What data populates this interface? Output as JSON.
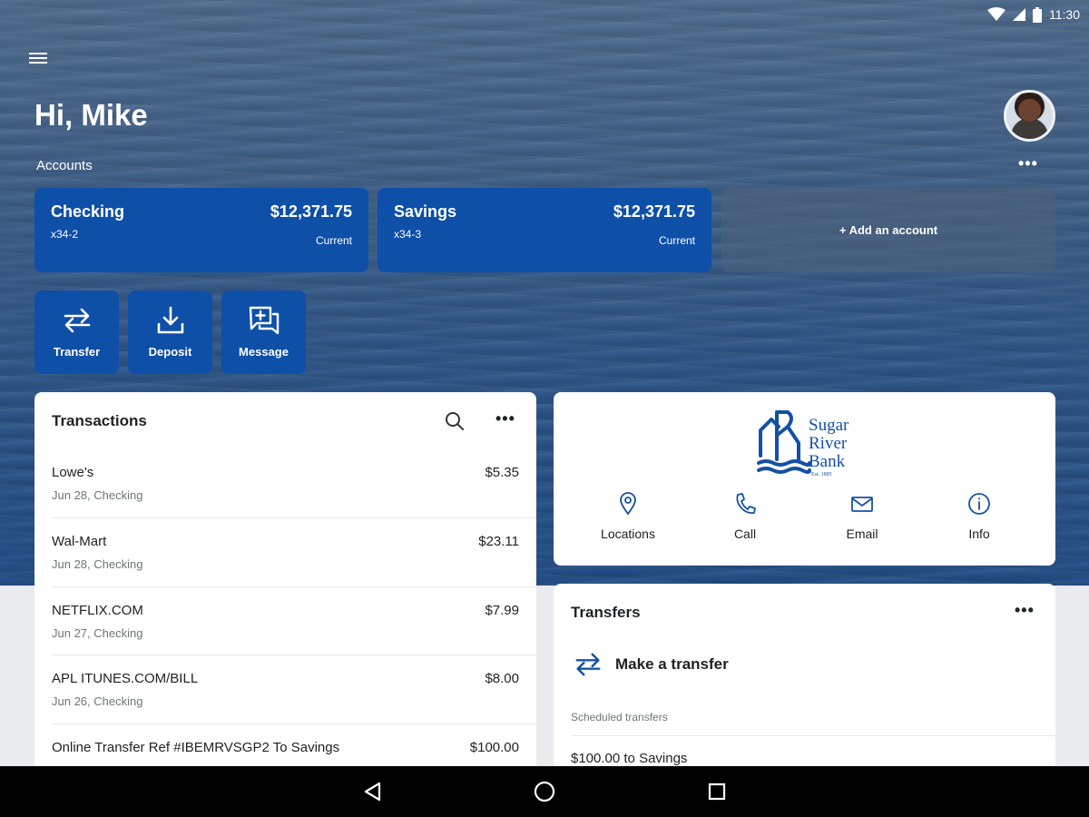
{
  "status_bar": {
    "time": "11:30"
  },
  "header": {
    "greeting": "Hi, Mike"
  },
  "accounts": {
    "label": "Accounts",
    "items": [
      {
        "name": "Checking",
        "number": "x34-2",
        "balance": "$12,371.75",
        "balance_type": "Current"
      },
      {
        "name": "Savings",
        "number": "x34-3",
        "balance": "$12,371.75",
        "balance_type": "Current"
      }
    ],
    "add_label": "+ Add an account"
  },
  "quick_actions": [
    {
      "label": "Transfer",
      "icon": "transfer-icon"
    },
    {
      "label": "Deposit",
      "icon": "deposit-icon"
    },
    {
      "label": "Message",
      "icon": "message-icon"
    }
  ],
  "transactions": {
    "title": "Transactions",
    "items": [
      {
        "name": "Lowe's",
        "sub": "Jun 28, Checking",
        "amount": "$5.35"
      },
      {
        "name": "Wal-Mart",
        "sub": "Jun 28, Checking",
        "amount": "$23.11"
      },
      {
        "name": "NETFLIX.COM",
        "sub": "Jun 27, Checking",
        "amount": "$7.99"
      },
      {
        "name": "APL ITUNES.COM/BILL",
        "sub": "Jun 26, Checking",
        "amount": "$8.00"
      },
      {
        "name": "Online Transfer Ref #IBEMRVSGP2 To Savings",
        "sub": "",
        "amount": "$100.00"
      }
    ]
  },
  "bank": {
    "logo_text": [
      "Sugar",
      "River",
      "Bank"
    ],
    "logo_est": "Est. 1885",
    "actions": [
      {
        "label": "Locations",
        "icon": "location-pin-icon"
      },
      {
        "label": "Call",
        "icon": "phone-icon"
      },
      {
        "label": "Email",
        "icon": "email-icon"
      },
      {
        "label": "Info",
        "icon": "info-icon"
      }
    ]
  },
  "transfers": {
    "title": "Transfers",
    "make_label": "Make a transfer",
    "scheduled_label": "Scheduled transfers",
    "scheduled": [
      "$100.00 to Savings"
    ]
  },
  "colors": {
    "brand_blue": "#0e4fa8",
    "card_bg": "#ffffff",
    "nav_bar": "#000000"
  }
}
